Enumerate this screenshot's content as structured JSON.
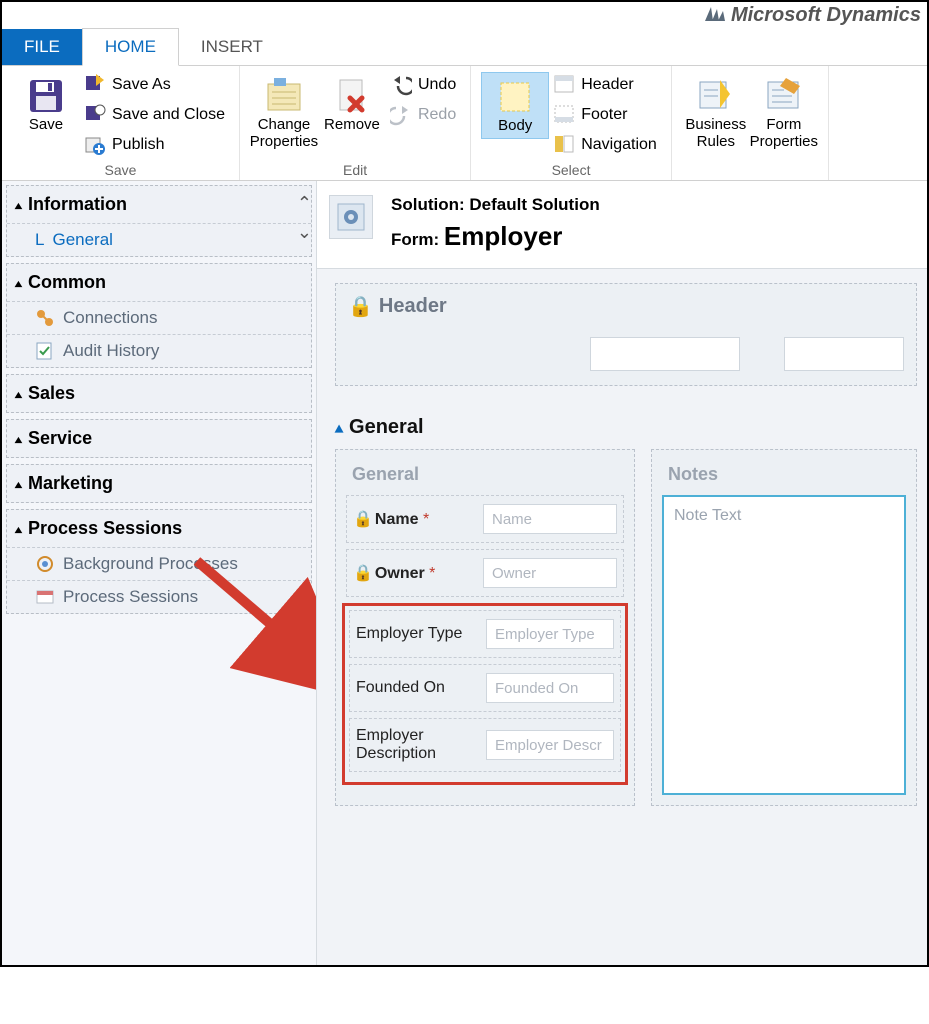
{
  "brand": "Microsoft Dynamics",
  "tabs": {
    "file": "FILE",
    "home": "HOME",
    "insert": "INSERT"
  },
  "ribbon": {
    "save_group": {
      "save": "Save",
      "save_as": "Save As",
      "save_close": "Save and Close",
      "publish": "Publish",
      "label": "Save"
    },
    "edit_group": {
      "change_props": "Change Properties",
      "remove": "Remove",
      "undo": "Undo",
      "redo": "Redo",
      "label": "Edit"
    },
    "select_group": {
      "body": "Body",
      "header": "Header",
      "footer": "Footer",
      "navigation": "Navigation",
      "label": "Select"
    },
    "extra_group": {
      "biz_rules": "Business Rules",
      "form_props": "Form Properties"
    }
  },
  "nav": {
    "information": {
      "title": "Information",
      "general": "General"
    },
    "common": {
      "title": "Common",
      "connections": "Connections",
      "audit": "Audit History"
    },
    "sales": {
      "title": "Sales"
    },
    "service": {
      "title": "Service"
    },
    "marketing": {
      "title": "Marketing"
    },
    "process": {
      "title": "Process Sessions",
      "bg": "Background Processes",
      "ps": "Process Sessions"
    }
  },
  "header": {
    "sol_label": "Solution:",
    "sol_value": "Default Solution",
    "form_label": "Form:",
    "form_value": "Employer"
  },
  "form": {
    "header_sec": "Header",
    "general_sec": "General",
    "col_general": "General",
    "col_notes": "Notes",
    "note_ph": "Note Text",
    "fields": {
      "name": {
        "label": "Name",
        "ph": "Name",
        "required": true,
        "locked": true
      },
      "owner": {
        "label": "Owner",
        "ph": "Owner",
        "required": true,
        "locked": true
      },
      "etype": {
        "label": "Employer Type",
        "ph": "Employer Type",
        "required": false,
        "locked": false
      },
      "founded": {
        "label": "Founded On",
        "ph": "Founded On",
        "required": false,
        "locked": false
      },
      "edesc": {
        "label": "Employer Description",
        "ph": "Employer Descr",
        "required": false,
        "locked": false
      }
    }
  }
}
